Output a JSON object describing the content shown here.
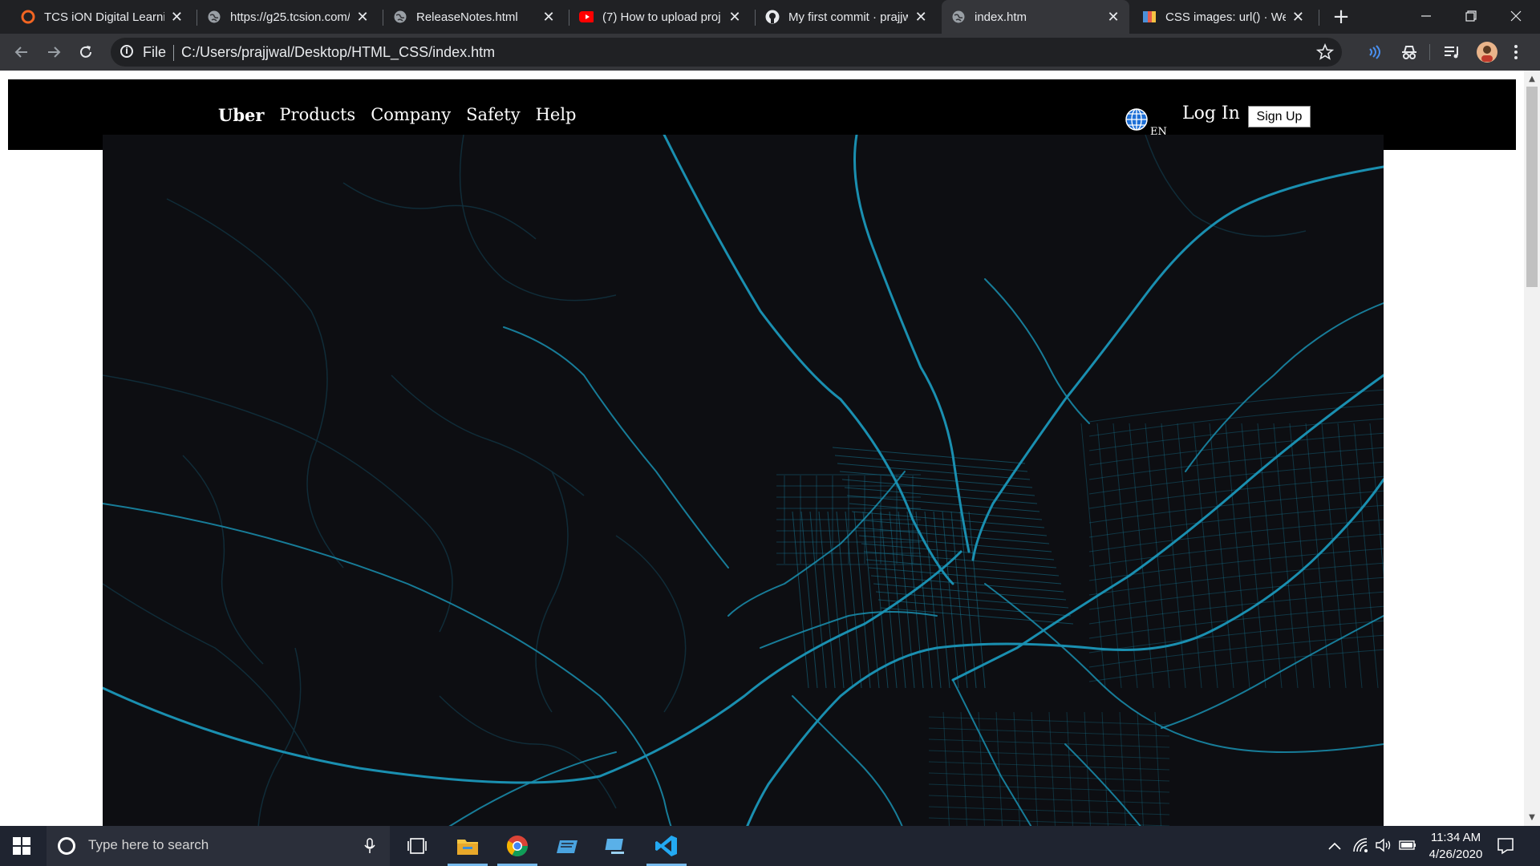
{
  "browser": {
    "tabs": [
      {
        "title": "TCS iON Digital Learnin",
        "icon": "tcs-icon",
        "active": false
      },
      {
        "title": "https://g25.tcsion.com/",
        "icon": "globe-icon",
        "active": false
      },
      {
        "title": "ReleaseNotes.html",
        "icon": "globe-icon",
        "active": false
      },
      {
        "title": "(7) How to upload proj",
        "icon": "youtube-icon",
        "active": false
      },
      {
        "title": "My first commit · prajjw",
        "icon": "github-icon",
        "active": false
      },
      {
        "title": "index.htm",
        "icon": "globe-icon",
        "active": true
      },
      {
        "title": "CSS images: url() · Web",
        "icon": "mdn-icon",
        "active": false
      }
    ],
    "close_glyph": "✕",
    "new_tab_glyph": "+",
    "address": {
      "scheme_label": "File",
      "url": "C:/Users/prajjwal/Desktop/HTML_CSS/index.htm"
    }
  },
  "page": {
    "nav": {
      "brand": "Uber",
      "items": [
        "Products",
        "Company",
        "Safety",
        "Help"
      ]
    },
    "language": "EN",
    "login_label": "Log In",
    "signup_label": "Sign Up",
    "hero_line_color": "#1a8fb0",
    "hero_bg_color": "#0d0e12"
  },
  "taskbar": {
    "search_placeholder": "Type here to search",
    "time": "11:34 AM",
    "date": "4/26/2020"
  }
}
